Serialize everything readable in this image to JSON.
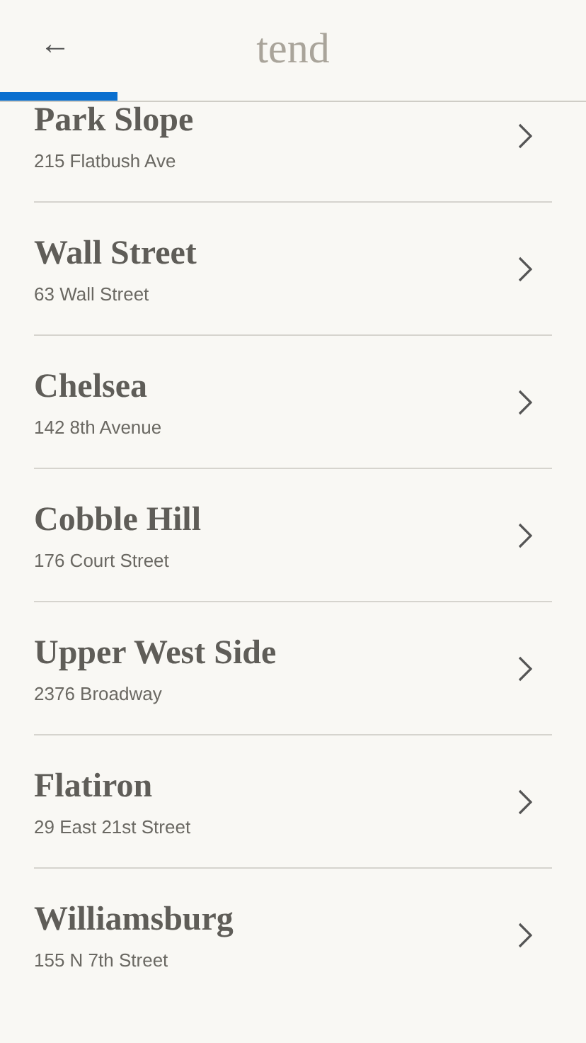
{
  "header": {
    "back_icon": "←",
    "logo": "tend",
    "progress": {
      "level": 0.2
    }
  },
  "locations": [
    {
      "name": "Park Slope",
      "address": "215 Flatbush Ave"
    },
    {
      "name": "Wall Street",
      "address": "63 Wall Street"
    },
    {
      "name": "Chelsea",
      "address": "142 8th Avenue"
    },
    {
      "name": "Cobble Hill",
      "address": "176 Court Street"
    },
    {
      "name": "Upper West Side",
      "address": "2376 Broadway"
    },
    {
      "name": "Flatiron",
      "address": "29 East 21st Street"
    },
    {
      "name": "Williamsburg",
      "address": "155 N 7th Street"
    }
  ]
}
